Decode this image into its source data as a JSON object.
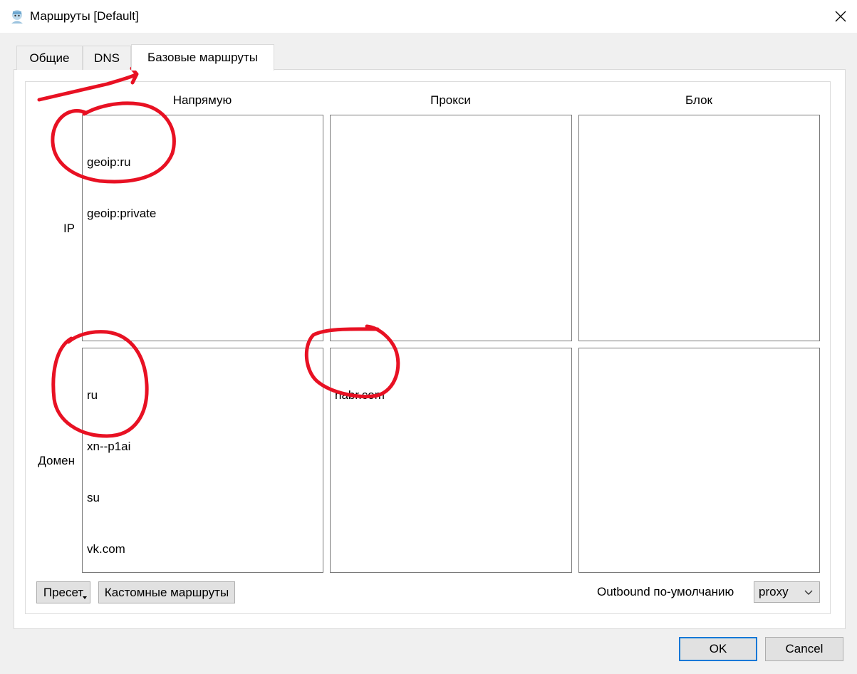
{
  "window": {
    "title": "Маршруты [Default]"
  },
  "tabs": [
    {
      "label": "Общие"
    },
    {
      "label": "DNS"
    },
    {
      "label": "Базовые маршруты"
    }
  ],
  "columns": [
    "Напрямую",
    "Прокси",
    "Блок"
  ],
  "rows": [
    "IP",
    "Домен"
  ],
  "ip": {
    "direct": [
      "geoip:ru",
      "geoip:private"
    ],
    "proxy": [],
    "block": []
  },
  "domain": {
    "direct": [
      "ru",
      "xn--p1ai",
      "su",
      "vk.com"
    ],
    "proxy": [
      "habr.com"
    ],
    "block": []
  },
  "buttons": {
    "preset": "Пресет",
    "custom_routes": "Кастомные маршруты",
    "ok": "OK",
    "cancel": "Cancel"
  },
  "outbound": {
    "label": "Outbound по-умолчанию",
    "value": "proxy"
  },
  "colors": {
    "accent": "#0078d7",
    "annotation": "#e81123"
  }
}
